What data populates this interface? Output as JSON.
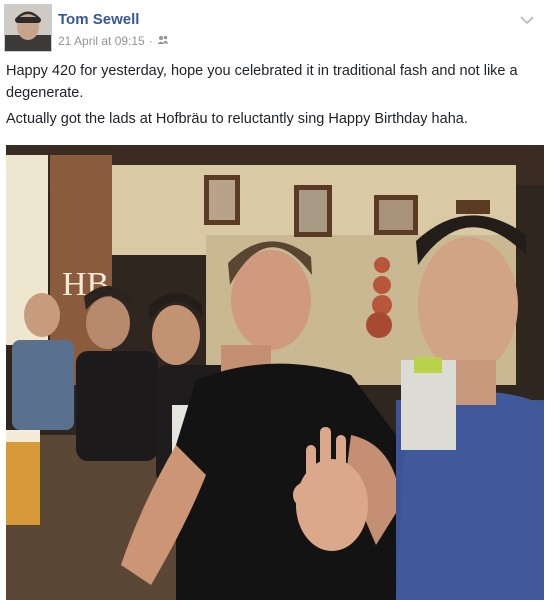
{
  "post": {
    "author": "Tom Sewell",
    "timestamp": "21 April at 09:15",
    "separator": "·",
    "audience_icon": "friends-icon",
    "paragraphs": [
      "Happy 420 for yesterday, hope you celebrated it in traditional fash and not like a degenerate.",
      "Actually got the lads at Hofbräu to reluctantly sing Happy Birthday haha."
    ],
    "options_icon": "chevron-down-icon"
  },
  "photo": {
    "signage_text": "HB"
  },
  "colors": {
    "author_link": "#365899",
    "meta_text": "#90949c",
    "body_text": "#1d2129"
  }
}
